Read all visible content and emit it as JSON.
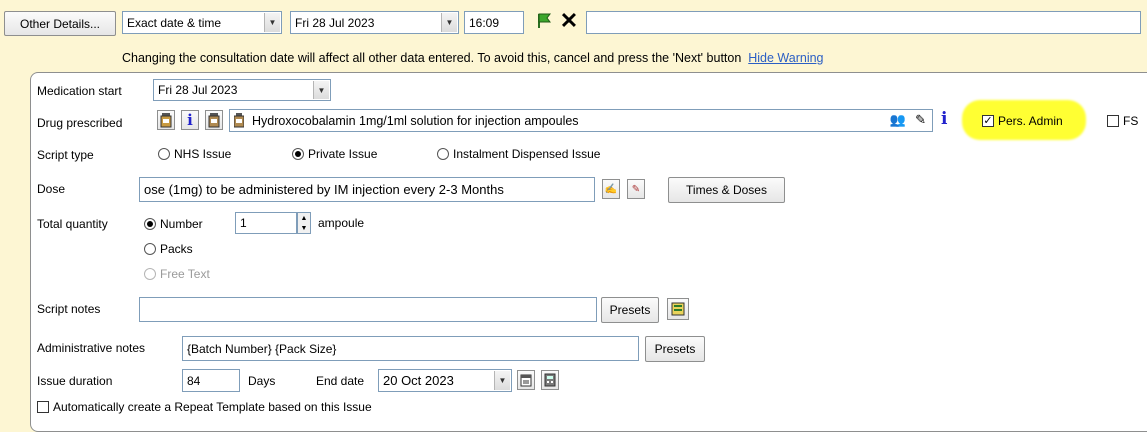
{
  "toolbar": {
    "other_details_label": "Other Details...",
    "date_mode": "Exact date & time",
    "date_value": "Fri 28 Jul 2023",
    "time_value": "16:09",
    "extra_input_value": ""
  },
  "warning": {
    "text": "Changing the consultation date will affect all other data entered. To avoid this, cancel and press the 'Next' button",
    "hide_link": "Hide Warning"
  },
  "form": {
    "medication_start_label": "Medication start",
    "medication_start_value": "Fri 28 Jul 2023",
    "drug_label": "Drug prescribed",
    "drug_value": "Hydroxocobalamin 1mg/1ml solution for injection ampoules",
    "pers_admin_label": "Pers. Admin",
    "fs_label": "FS",
    "script_type_label": "Script type",
    "script_types": [
      "NHS Issue",
      "Private Issue",
      "Instalment Dispensed Issue"
    ],
    "dose_label": "Dose",
    "dose_value": "ose (1mg) to be administered by IM injection every  2-3 Months",
    "times_doses_label": "Times & Doses",
    "total_quantity_label": "Total quantity",
    "quantity_options": [
      "Number",
      "Packs",
      "Free Text"
    ],
    "quantity_value": "1",
    "quantity_unit": "ampoule",
    "script_notes_label": "Script notes",
    "script_notes_value": "",
    "presets_label": "Presets",
    "admin_notes_label": "Administrative notes",
    "admin_notes_value": "{Batch Number} {Pack Size}",
    "issue_duration_label": "Issue duration",
    "issue_duration_value": "84",
    "days_label": "Days",
    "end_date_label": "End date",
    "end_date_value": "20 Oct 2023",
    "auto_template_label": "Automatically create a Repeat Template based on this Issue"
  },
  "colors": {
    "background": "#fdf6d3",
    "highlight": "#ffff33",
    "info_icon": "#2222cc",
    "link": "#2b5fc4"
  }
}
